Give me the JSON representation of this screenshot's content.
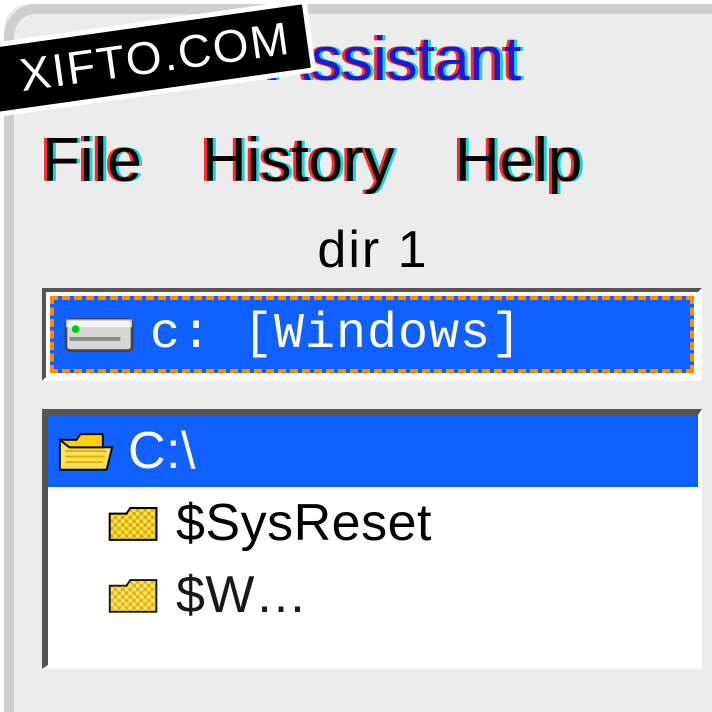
{
  "window": {
    "title": "Sync Assistant"
  },
  "menu": {
    "file": "File",
    "history": "History",
    "help": "Help"
  },
  "panel": {
    "title": "dir 1",
    "drive_label": "c: [Windows]"
  },
  "tree": {
    "root": "C:\\",
    "items": [
      "$SysReset"
    ]
  },
  "watermark": "XIFTO.COM"
}
